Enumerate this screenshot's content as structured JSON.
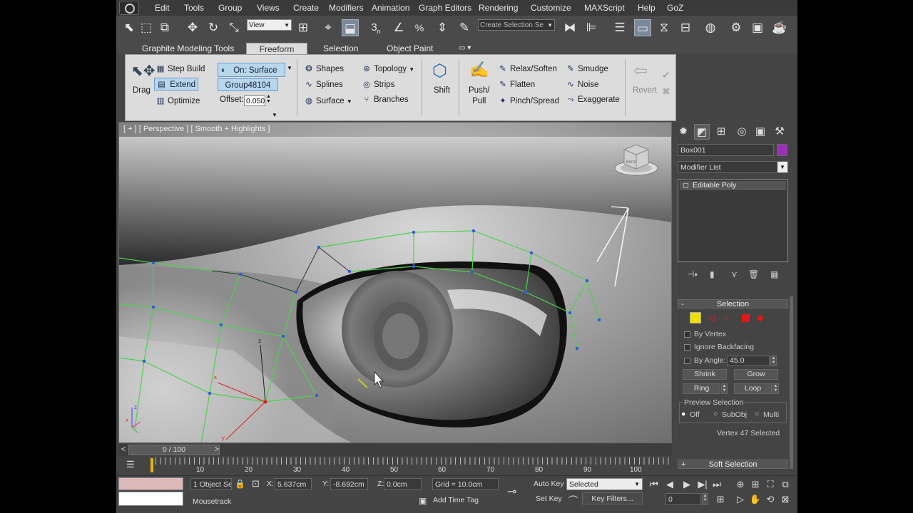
{
  "menu": {
    "items": [
      "Edit",
      "Tools",
      "Group",
      "Views",
      "Create",
      "Modifiers",
      "Animation",
      "Graph Editors",
      "Rendering",
      "Customize",
      "MAXScript",
      "Help",
      "GoZ"
    ]
  },
  "toolbar": {
    "reference_coord": "View",
    "selection_set_placeholder": "Create Selection Se",
    "snap_label": "3"
  },
  "ribbon": {
    "tabs": [
      "Graphite Modeling Tools",
      "Freeform",
      "Selection",
      "Object Paint"
    ],
    "active_tab": "Freeform",
    "drag": {
      "label": "Drag"
    },
    "step_build": "Step Build",
    "extend": "Extend",
    "optimize": "Optimize",
    "on_surface": "On: Surface",
    "group": "Group48104",
    "offset_label": "Offset:",
    "offset_value": "0.050",
    "shapes": "Shapes",
    "splines": "Splines",
    "surface": "Surface",
    "topology": "Topology",
    "strips": "Strips",
    "branches": "Branches",
    "shift": "Shift",
    "push_pull": "Push/\nPull",
    "relax_soften": "Relax/Soften",
    "flatten": "Flatten",
    "pinch_spread": "Pinch/Spread",
    "smudge": "Smudge",
    "noise": "Noise",
    "exaggerate": "Exaggerate",
    "revert": "Revert"
  },
  "viewport": {
    "label": "[ + ] [ Perspective ] [ Smooth + Highlights ]",
    "viewcube_face": "BACK",
    "axis_x": "x",
    "axis_y": "y",
    "axis_z": "z"
  },
  "command_panel": {
    "object_name": "Box001",
    "object_color": "#9b30b8",
    "modifier_list": "Modifier List",
    "stack_item": "Editable Poly",
    "selection_rollout": "Selection",
    "by_vertex": "By Vertex",
    "ignore_backfacing": "Ignore Backfacing",
    "by_angle": "By Angle:",
    "by_angle_value": "45.0",
    "shrink": "Shrink",
    "grow": "Grow",
    "ring": "Ring",
    "loop": "Loop",
    "preview_selection": "Preview Selection",
    "preview_off": "Off",
    "preview_subobj": "SubObj",
    "preview_multi": "Multi",
    "selection_status": "Vertex 47 Selected",
    "soft_selection": "Soft Selection"
  },
  "timeline": {
    "frame_display": "0 / 100",
    "ticks": [
      "10",
      "20",
      "30",
      "40",
      "50",
      "60",
      "70",
      "80",
      "90",
      "100"
    ]
  },
  "status": {
    "selection_count": "1 Object Se",
    "x_label": "X:",
    "x_value": "5.637cm",
    "y_label": "Y:",
    "y_value": "-8.692cm",
    "z_label": "Z:",
    "z_value": "0.0cm",
    "grid": "Grid = 10.0cm",
    "auto_key": "Auto Key",
    "key_mode": "Selected",
    "set_key": "Set Key",
    "key_filters": "Key Filters...",
    "frame_value": "0",
    "mousetrack": "Mousetrack",
    "add_time_tag": "Add Time Tag"
  },
  "colors": {
    "accent_selected": "#b8d6ee",
    "wire_green": "#4cd24c",
    "vertex_blue": "#2f5bd8",
    "swatch_color": "#dcb8b8"
  }
}
